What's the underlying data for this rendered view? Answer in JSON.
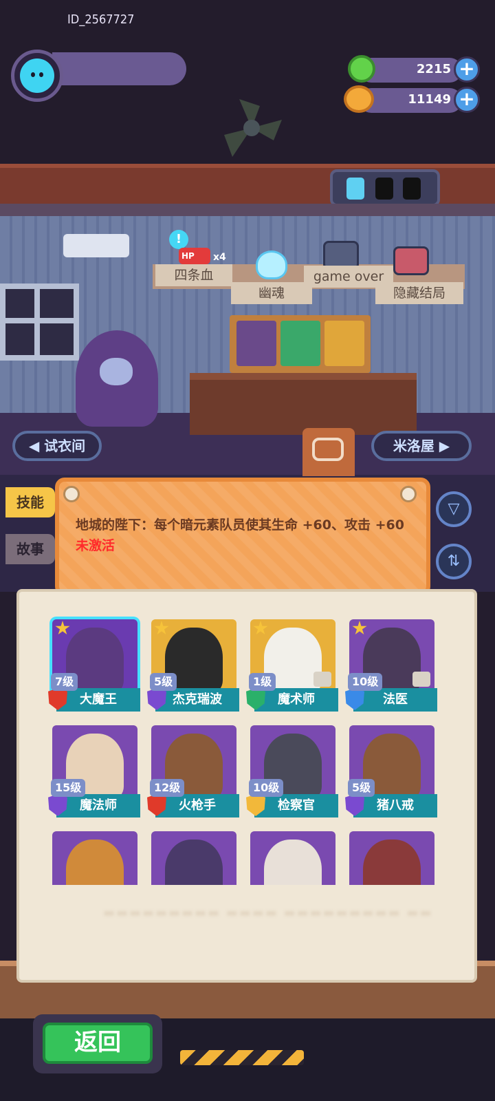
{
  "header": {
    "user_id": "ID_2567727",
    "currencies": [
      {
        "icon": "green-gem-icon",
        "value": "2215"
      },
      {
        "icon": "gold-coin-icon",
        "value": "11149"
      }
    ],
    "plus_label": "+"
  },
  "room": {
    "endings": [
      {
        "label": "四条血",
        "badge": "HP",
        "count": "x4"
      },
      {
        "label": "幽魂"
      },
      {
        "label": "game over"
      },
      {
        "label": "隐藏结局"
      }
    ],
    "nav_left": "◀ 试衣间",
    "nav_right": "米洛屋 ▶",
    "info_badge": "!"
  },
  "skill_panel": {
    "tabs": [
      "技能",
      "故事"
    ],
    "text": "地城的陛下：每个暗元素队员使其生命 +60、攻击 +60",
    "status": "未激活",
    "filter_icon": "▽",
    "sort_icon": "⇅"
  },
  "characters": [
    {
      "level": "7级",
      "name": "大魔王",
      "bg": "#6a3bb0",
      "char": "#5b3a80",
      "shield": "#e03a2a",
      "selected": true,
      "star": true
    },
    {
      "level": "5级",
      "name": "杰克瑞波",
      "bg": "#e8b03a",
      "char": "#2a2a2a",
      "shield": "#7a4ad0",
      "star": true
    },
    {
      "level": "1级",
      "name": "魔术师",
      "bg": "#e8b03a",
      "char": "#f2f0ea",
      "shield": "#2ab06a",
      "star": true,
      "shirt": true
    },
    {
      "level": "10级",
      "name": "法医",
      "bg": "#7a4ab0",
      "char": "#4a3a5a",
      "shield": "#3a8ae8",
      "star": true,
      "shirt": true
    },
    {
      "level": "15级",
      "name": "魔法师",
      "bg": "#7a4ab0",
      "char": "#e8d2b8",
      "shield": "#7a4ad0"
    },
    {
      "level": "12级",
      "name": "火枪手",
      "bg": "#7a4ab0",
      "char": "#8a5a3a",
      "shield": "#e03a2a"
    },
    {
      "level": "10级",
      "name": "检察官",
      "bg": "#7a4ab0",
      "char": "#4a4a5a",
      "shield": "#f2b83a"
    },
    {
      "level": "5级",
      "name": "猪八戒",
      "bg": "#7a4ab0",
      "char": "#8a5a3a",
      "shield": "#7a4ad0"
    },
    {
      "level": "",
      "name": "",
      "bg": "#7a4ab0",
      "char": "#d08a3a"
    },
    {
      "level": "",
      "name": "",
      "bg": "#7a4ab0",
      "char": "#4a3a6a"
    },
    {
      "level": "",
      "name": "",
      "bg": "#7a4ab0",
      "char": "#e8e0d8"
    },
    {
      "level": "",
      "name": "",
      "bg": "#7a4ab0",
      "char": "#8a3a3a"
    }
  ],
  "footer": {
    "back_label": "返回"
  }
}
